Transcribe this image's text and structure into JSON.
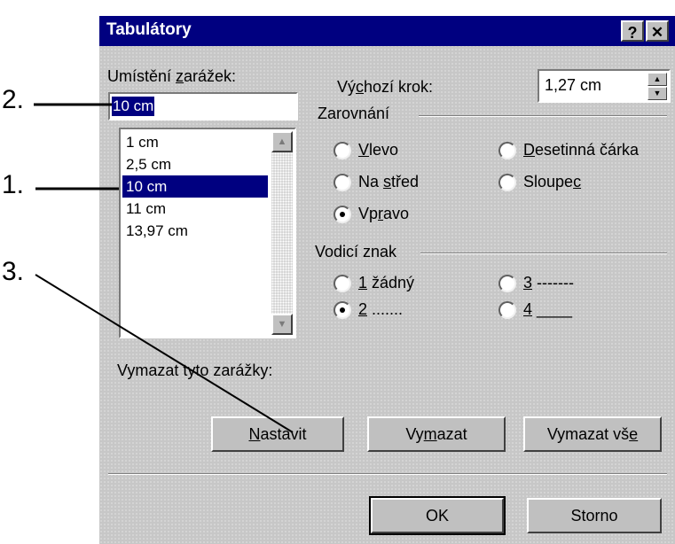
{
  "dialog": {
    "title": "Tabulátory",
    "help_btn": "?",
    "close_btn": "✕"
  },
  "positions": {
    "label_pre": "Umístění ",
    "label_ul": "z",
    "label_post": "arážek:",
    "value": "10 cm",
    "items": [
      "1 cm",
      "2,5 cm",
      "10 cm",
      "11 cm",
      "13,97 cm"
    ],
    "selected_index": 2
  },
  "default_step": {
    "label_pre": "Vý",
    "label_ul": "c",
    "label_post": "hozí krok:",
    "value": "1,27 cm"
  },
  "alignment": {
    "group_label": "Zarovnání",
    "left": {
      "ul": "V",
      "rest": "levo"
    },
    "center": {
      "pre": "Na ",
      "ul": "s",
      "rest": "třed"
    },
    "right": {
      "pre": "Vp",
      "ul": "r",
      "rest": "avo"
    },
    "decimal": {
      "ul": "D",
      "rest": "esetinná čárka"
    },
    "bar": {
      "pre": "Sloupe",
      "ul": "c"
    },
    "selected": "right"
  },
  "leader": {
    "group_label": "Vodicí znak",
    "opt1": {
      "ul": "1",
      "rest": " žádný"
    },
    "opt2": {
      "ul": "2",
      "rest": " ......."
    },
    "opt3": {
      "ul": "3",
      "rest": " -------"
    },
    "opt4": {
      "ul": "4",
      "rest": " ____"
    },
    "selected": "2"
  },
  "clear_label": "Vymazat tyto zarážky:",
  "buttons": {
    "set": {
      "ul": "N",
      "rest": "astavit"
    },
    "clear": {
      "pre": "Vy",
      "ul": "m",
      "rest": "azat"
    },
    "clear_all": {
      "pre": "Vymazat vš",
      "ul": "e"
    },
    "ok": "OK",
    "cancel": "Storno"
  },
  "callouts": [
    "1.",
    "2.",
    "3."
  ]
}
